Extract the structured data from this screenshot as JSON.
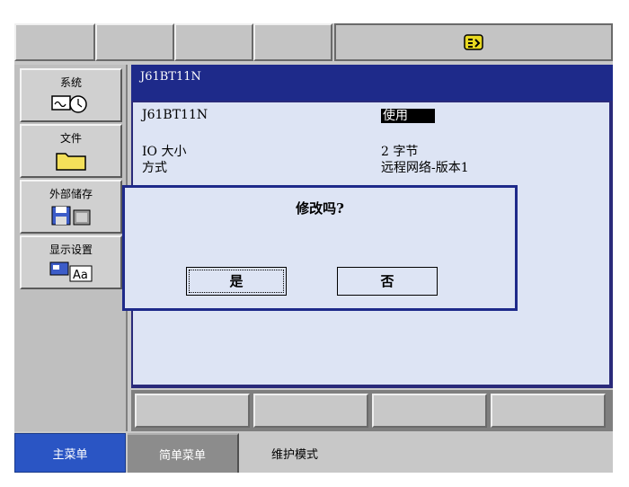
{
  "side_menu": [
    {
      "label": "系统",
      "icon": "system-clock-icon"
    },
    {
      "label": "文件",
      "icon": "folder-icon"
    },
    {
      "label": "外部储存",
      "icon": "storage-icon"
    },
    {
      "label": "显示设置",
      "icon": "display-font-icon"
    }
  ],
  "top_bar": {
    "icon": "hand-tool-icon"
  },
  "content": {
    "title": "J61BT11N",
    "device_name": "J61BT11N",
    "device_status": "使用",
    "io_size_label": "IO 大小",
    "io_size_value": "2  字节",
    "mode_label": "方式",
    "mode_value": "远程网络-版本1"
  },
  "dialog": {
    "title": "修改吗?",
    "yes_label": "是",
    "no_label": "否"
  },
  "bottom_bar": {
    "main_menu": "主菜单",
    "simple_menu": "简单菜单",
    "mode": "维护模式"
  },
  "colors": {
    "title_bar": "#1e2a8a",
    "panel": "#dde4f4",
    "main_tab": "#2a55c4"
  }
}
